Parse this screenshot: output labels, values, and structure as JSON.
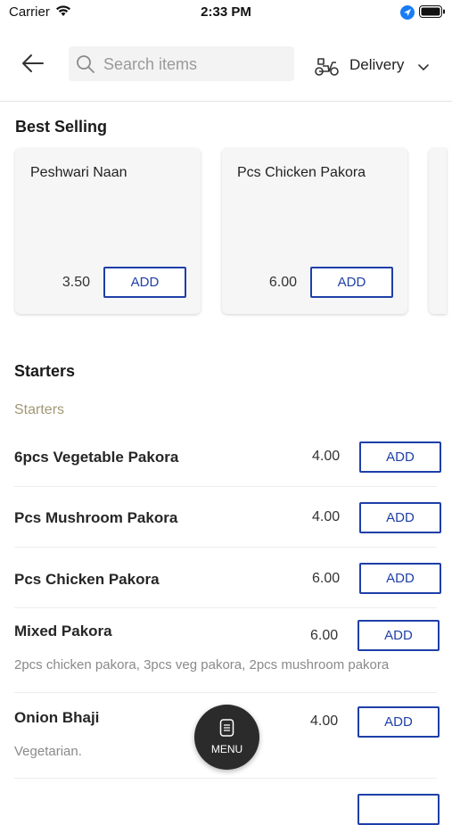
{
  "status_bar": {
    "carrier": "Carrier",
    "time": "2:33 PM"
  },
  "header": {
    "search_placeholder": "Search items",
    "order_mode": "Delivery"
  },
  "best_selling": {
    "title": "Best Selling",
    "items": [
      {
        "name": "Peshwari Naan",
        "price": "3.50",
        "button": "ADD"
      },
      {
        "name": "Pcs Chicken Pakora",
        "price": "6.00",
        "button": "ADD"
      }
    ]
  },
  "starters": {
    "title": "Starters",
    "subcategory": "Starters",
    "items": [
      {
        "name": "6pcs Vegetable Pakora",
        "price": "4.00",
        "button": "ADD",
        "description": ""
      },
      {
        "name": "Pcs Mushroom Pakora",
        "price": "4.00",
        "button": "ADD",
        "description": ""
      },
      {
        "name": "Pcs Chicken Pakora",
        "price": "6.00",
        "button": "ADD",
        "description": ""
      },
      {
        "name": "Mixed Pakora",
        "price": "6.00",
        "button": "ADD",
        "description": "2pcs chicken pakora, 3pcs veg pakora, 2pcs mushroom pakora"
      },
      {
        "name": "Onion Bhaji",
        "price": "4.00",
        "button": "ADD",
        "description": "Vegetarian."
      }
    ]
  },
  "menu_button": {
    "label": "MENU"
  },
  "colors": {
    "accent": "#1e3fa8",
    "subcategory": "#a29876",
    "fab": "#2b2b2b"
  }
}
